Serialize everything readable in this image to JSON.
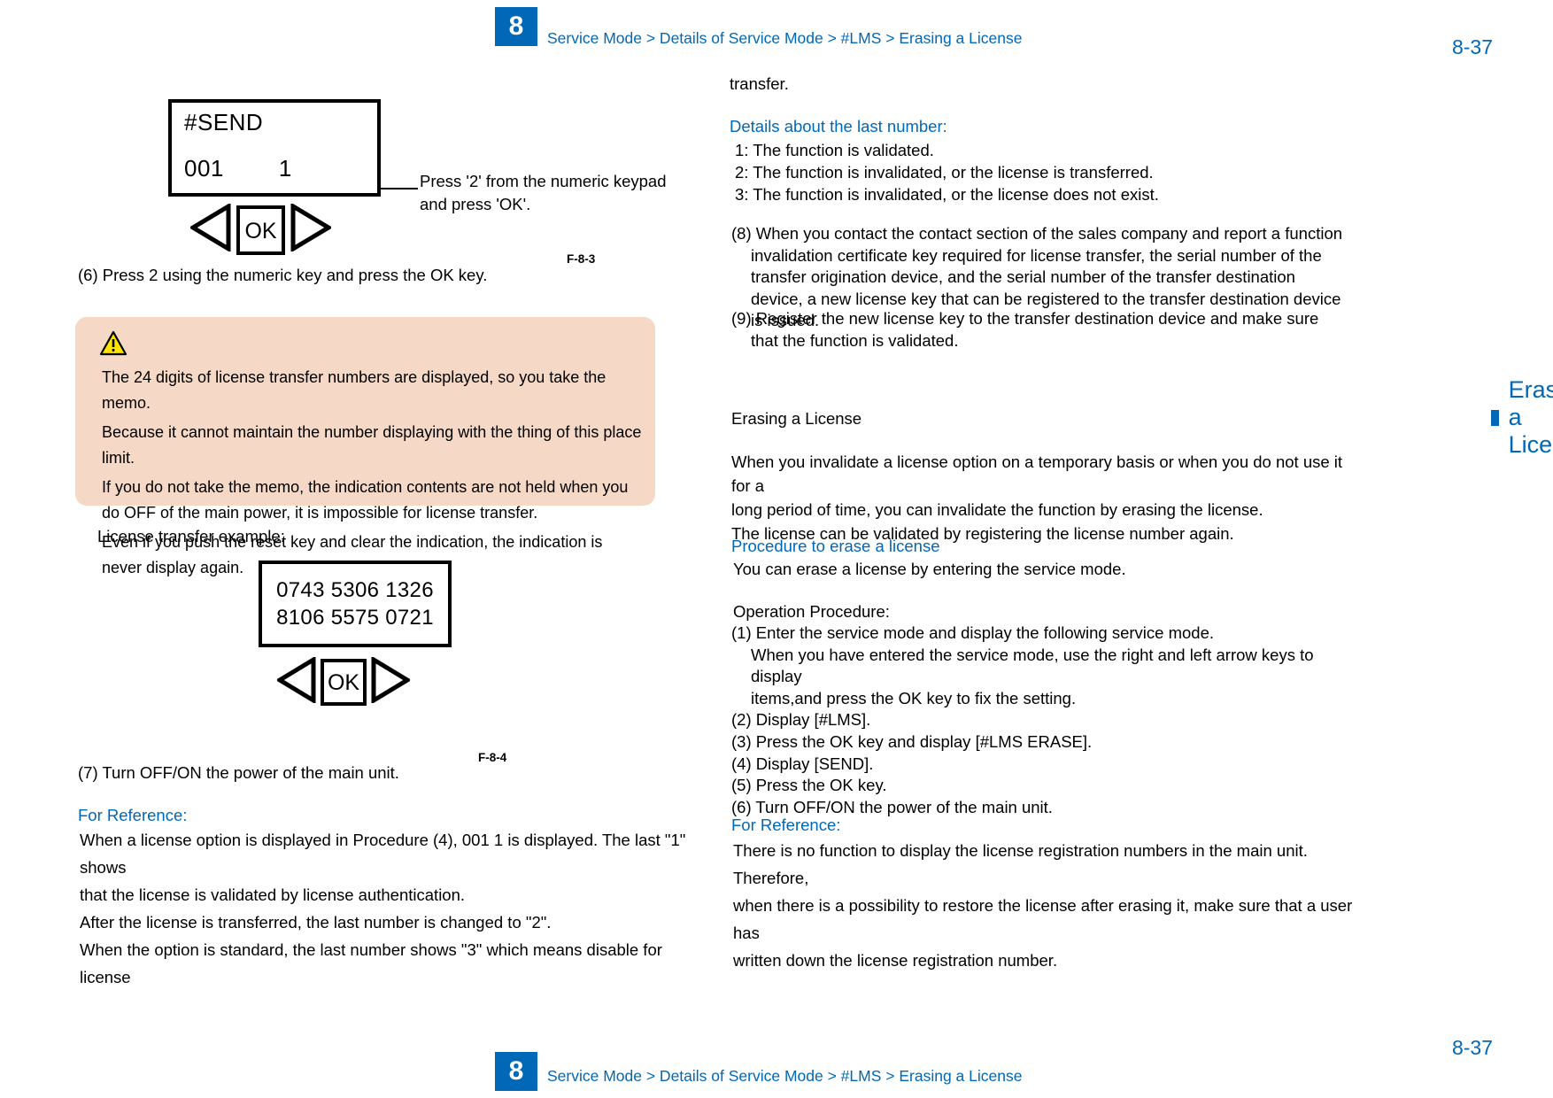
{
  "header": {
    "chapter": "8",
    "breadcrumb": "Service Mode > Details of Service Mode > #LMS > Erasing a License",
    "page_number": "8-37"
  },
  "footer": {
    "chapter": "8",
    "breadcrumb": "Service Mode > Details of Service Mode > #LMS > Erasing a License",
    "page_number": "8-37"
  },
  "left_column": {
    "figure1": {
      "lcd_line1": "#SEND",
      "lcd_line2_left": "001",
      "lcd_line2_right": "1",
      "ok_key_label": "OK",
      "callout": "Press '2' from the numeric keypad and press 'OK'.",
      "caption": "F-8-3"
    },
    "step6": "(6) Press 2 using the numeric key and press the OK key.",
    "caution": {
      "icon": "warning-triangle-icon",
      "lines": [
        "The 24 digits of license transfer numbers are displayed, so you take the memo.",
        "Because it cannot maintain the number displaying with the thing of this place limit.",
        "If you do not take the memo, the indication contents are not held when you do OFF of the main power, it is impossible for license transfer.",
        "Even if you push the reset key and clear the indication, the indication is never display again."
      ],
      "background_color": "#f5d9c6"
    },
    "license_example_label": "License transfer example:",
    "figure2": {
      "license_number_line1": "0743 5306 1326",
      "license_number_line2": "8106 5575 0721",
      "ok_key_label": "OK",
      "caption": "F-8-4"
    },
    "step7": "(7) Turn OFF/ON the power of the main unit.",
    "for_reference": {
      "title": "For Reference:",
      "lines": [
        "When a license option is displayed in Procedure (4), 001 1 is displayed. The last \"1\" shows",
        "that the license is validated by license authentication.",
        "After the license is transferred, the last number is changed to \"2\".",
        "When the option is standard, the last number shows \"3\" which means disable for license"
      ]
    }
  },
  "right_column": {
    "continued_word": "transfer.",
    "details_heading": "Details about the last number:",
    "details_items": [
      "1: The function is validated.",
      "2: The function is invalidated, or the license is transferred.",
      "3: The function is invalidated, or the license does not exist."
    ],
    "step8": "(8) When you contact the contact section of the sales company and report a function invalidation certificate key required for license transfer, the serial number of the transfer origination device, and the serial number of the transfer destination device, a new license key that can be registered to the transfer destination device is issued.",
    "step9": "(9) Register the new license key to the transfer destination device and make sure that the function is validated.",
    "section_title": "Erasing a License",
    "section_subtitle": "Erasing a License",
    "section_body": [
      "When you invalidate a license option on a temporary basis or when you do not use it for a",
      "long period of time, you can invalidate the function by erasing the license.",
      "The license can be validated by registering the license number again."
    ],
    "procedure_heading": "Procedure to erase a license",
    "procedure_intro": "You can erase a license by entering the service mode.",
    "operation_label": "Operation Procedure:",
    "operation_steps": [
      "(1) Enter the service mode and display the following service mode.",
      "When you have entered the service mode, use the right and left arrow keys to display",
      "items,and press the OK key to fix the setting.",
      "(2) Display [#LMS].",
      "(3) Press the OK key and display [#LMS ERASE].",
      "(4) Display [SEND].",
      "(5) Press the OK key.",
      "(6) Turn OFF/ON the power of the main unit."
    ],
    "for_reference": {
      "title": "For Reference:",
      "lines": [
        "There is no function to display the license registration numbers in the main unit. Therefore,",
        "when there is a possibility to restore the license after erasing it, make sure that a user has",
        "written down the license registration number."
      ]
    }
  },
  "colors": {
    "accent_blue": "#0068b7",
    "caution_bg": "#f5d9c6"
  }
}
